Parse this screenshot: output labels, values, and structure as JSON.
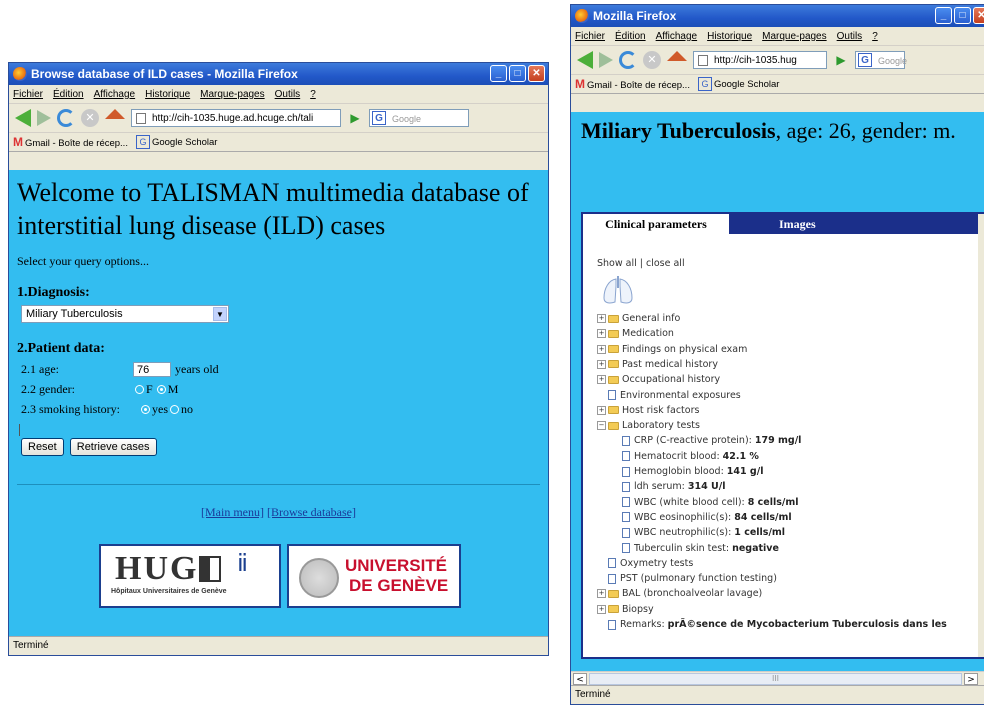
{
  "left": {
    "title": "Browse database of ILD cases - Mozilla Firefox",
    "menu": [
      "Fichier",
      "Édition",
      "Affichage",
      "Historique",
      "Marque-pages",
      "Outils",
      "?"
    ],
    "url": "http://cih-1035.huge.ad.hcuge.ch/tali",
    "search_placeholder": "Google",
    "bookmarks": [
      "Gmail - Boîte de récep...",
      "Google Scholar"
    ],
    "heading": "Welcome to TALISMAN multimedia database of interstitial lung disease (ILD) cases",
    "intro": "Select your query options...",
    "diagnosis_label": "1.Diagnosis:",
    "diagnosis_value": "Miliary Tuberculosis",
    "patient_label": "2.Patient data:",
    "age_label": "2.1 age:",
    "age_value": "76",
    "age_unit": "years old",
    "gender_label": "2.2 gender:",
    "gender_f": "F",
    "gender_m": "M",
    "smoking_label": "2.3 smoking history:",
    "smoking_yes": "yes",
    "smoking_no": "no",
    "reset_label": "Reset",
    "retrieve_label": "Retrieve cases",
    "link_main": "[Main menu]",
    "link_browse": "[Browse database]",
    "hug_logo_text": "HUG",
    "hug_logo_sub": "Hôpitaux Universitaires de Genève",
    "unige_logo_line1": "UNIVERSITÉ",
    "unige_logo_line2": "DE GENÈVE",
    "status": "Terminé"
  },
  "right": {
    "title": "Mozilla Firefox",
    "menu": [
      "Fichier",
      "Édition",
      "Affichage",
      "Historique",
      "Marque-pages",
      "Outils",
      "?"
    ],
    "url": "http://cih-1035.hug",
    "search_placeholder": "Google",
    "bookmarks": [
      "Gmail - Boîte de récep...",
      "Google Scholar"
    ],
    "heading_bold": "Miliary Tuberculosis",
    "heading_rest": ", age: 26, gender: m.",
    "tab_clinical": "Clinical parameters",
    "tab_images": "Images",
    "show_close": "Show all | close all",
    "tree": [
      {
        "kind": "folder",
        "label": "General info"
      },
      {
        "kind": "folder",
        "label": "Medication"
      },
      {
        "kind": "folder",
        "label": "Findings on physical exam"
      },
      {
        "kind": "folder",
        "label": "Past medical history"
      },
      {
        "kind": "folder",
        "label": "Occupational history"
      },
      {
        "kind": "doc",
        "label": "Environmental exposures"
      },
      {
        "kind": "folder",
        "label": "Host risk factors"
      },
      {
        "kind": "folder-open",
        "label": "Laboratory tests"
      },
      {
        "kind": "leaf",
        "label": "CRP (C-reactive protein):",
        "value": "179 mg/l"
      },
      {
        "kind": "leaf",
        "label": "Hematocrit blood:",
        "value": "42.1 %"
      },
      {
        "kind": "leaf",
        "label": "Hemoglobin blood:",
        "value": "141 g/l"
      },
      {
        "kind": "leaf",
        "label": "ldh serum:",
        "value": "314 U/l"
      },
      {
        "kind": "leaf",
        "label": "WBC (white blood cell):",
        "value": "8 cells/ml"
      },
      {
        "kind": "leaf",
        "label": "WBC eosinophilic(s):",
        "value": "84 cells/ml"
      },
      {
        "kind": "leaf",
        "label": "WBC neutrophilic(s):",
        "value": "1 cells/ml"
      },
      {
        "kind": "leaf",
        "label": "Tuberculin skin test:",
        "value": "negative"
      },
      {
        "kind": "doc",
        "label": "Oxymetry tests"
      },
      {
        "kind": "doc",
        "label": "PST (pulmonary function testing)"
      },
      {
        "kind": "folder",
        "label": "BAL (bronchoalveolar lavage)"
      },
      {
        "kind": "folder",
        "label": "Biopsy"
      },
      {
        "kind": "doc",
        "label": "Remarks:",
        "value": "prÃ©sence de Mycobacterium Tuberculosis dans les"
      }
    ],
    "status": "Terminé"
  }
}
